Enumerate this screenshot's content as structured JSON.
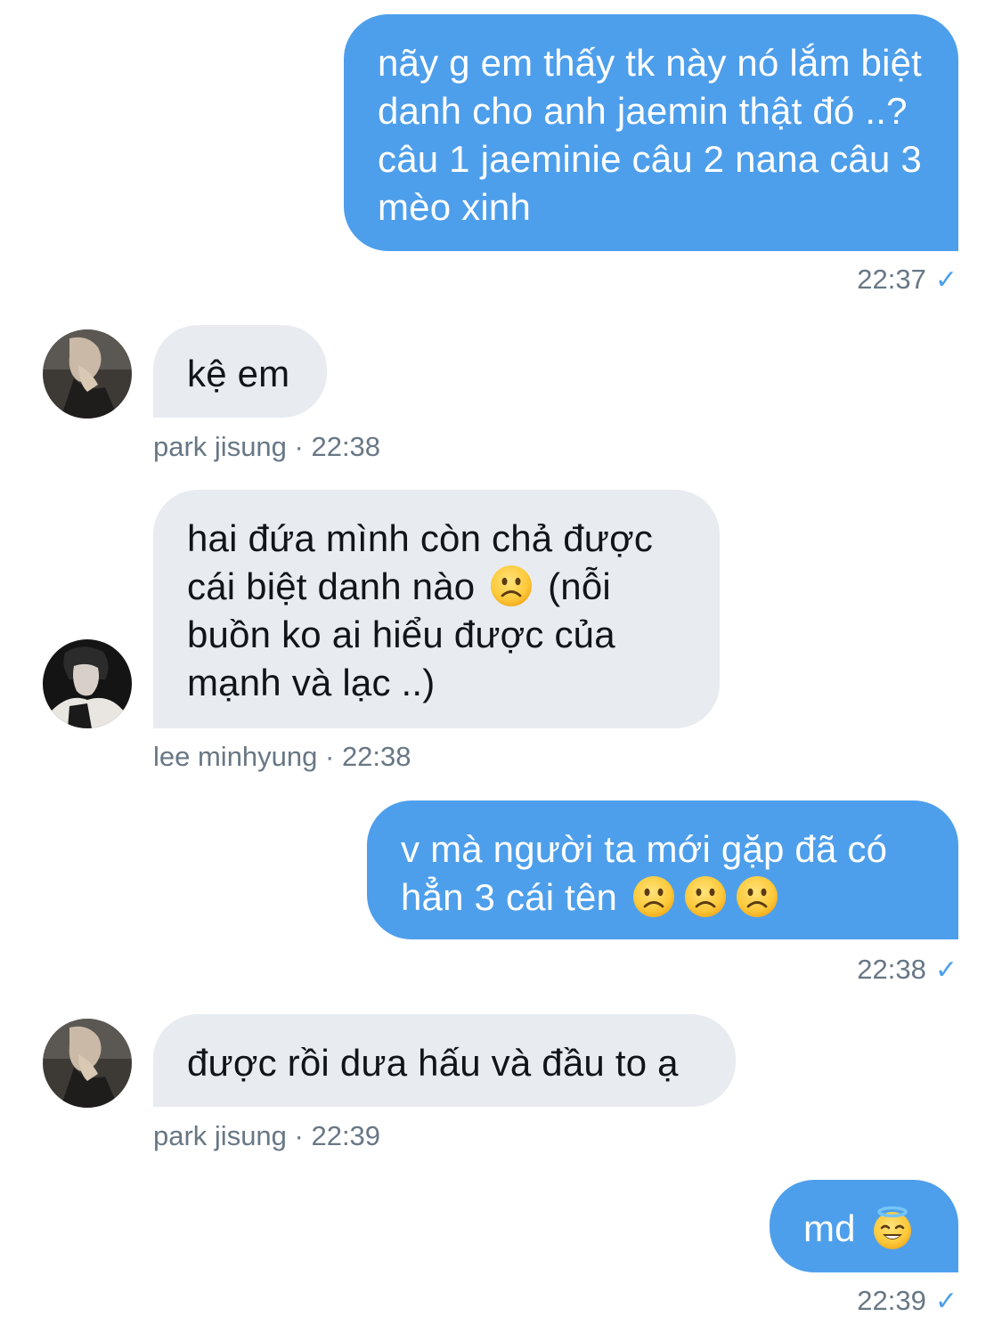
{
  "messages": [
    {
      "id": "m1",
      "direction": "outgoing",
      "text": "nãy g em thấy tk này nó lắm biệt danh cho anh jaemin thật đó ..? câu 1 jaeminie câu 2 nana câu 3 mèo xinh",
      "time": "22:37",
      "status_icon": "check-icon"
    },
    {
      "id": "m2",
      "direction": "incoming",
      "sender": "park jisung",
      "meta": "park jisung · 22:38",
      "text": "kệ em",
      "avatar": "avatar-park-jisung"
    },
    {
      "id": "m3",
      "direction": "incoming",
      "sender": "lee minhyung",
      "meta": "lee minhyung · 22:38",
      "text_before_emoji": "hai đứa mình còn chả được cái biệt danh nào ",
      "emoji": "frowning-face-emoji",
      "text_after_emoji": " (nỗi buồn ko ai hiểu được của mạnh và lạc ..)",
      "avatar": "avatar-lee-minhyung"
    },
    {
      "id": "m4",
      "direction": "outgoing",
      "text": "v mà người ta mới gặp đã có hẳn 3 cái tên ",
      "emojis": [
        "frowning-face-emoji",
        "frowning-face-emoji",
        "frowning-face-emoji"
      ],
      "time": "22:38",
      "status_icon": "check-icon"
    },
    {
      "id": "m5",
      "direction": "incoming",
      "sender": "park jisung",
      "meta": "park jisung · 22:39",
      "text": "được rồi dưa hấu và đầu to ạ",
      "avatar": "avatar-park-jisung"
    },
    {
      "id": "m6",
      "direction": "outgoing",
      "text": "md ",
      "emoji": "smiling-face-with-halo-emoji",
      "time": "22:39",
      "status_icon": "check-icon"
    }
  ],
  "colors": {
    "outgoing_bubble": "#4e9feb",
    "incoming_bubble": "#e8ecf0",
    "meta_text": "#687785",
    "check": "#4e9feb"
  }
}
